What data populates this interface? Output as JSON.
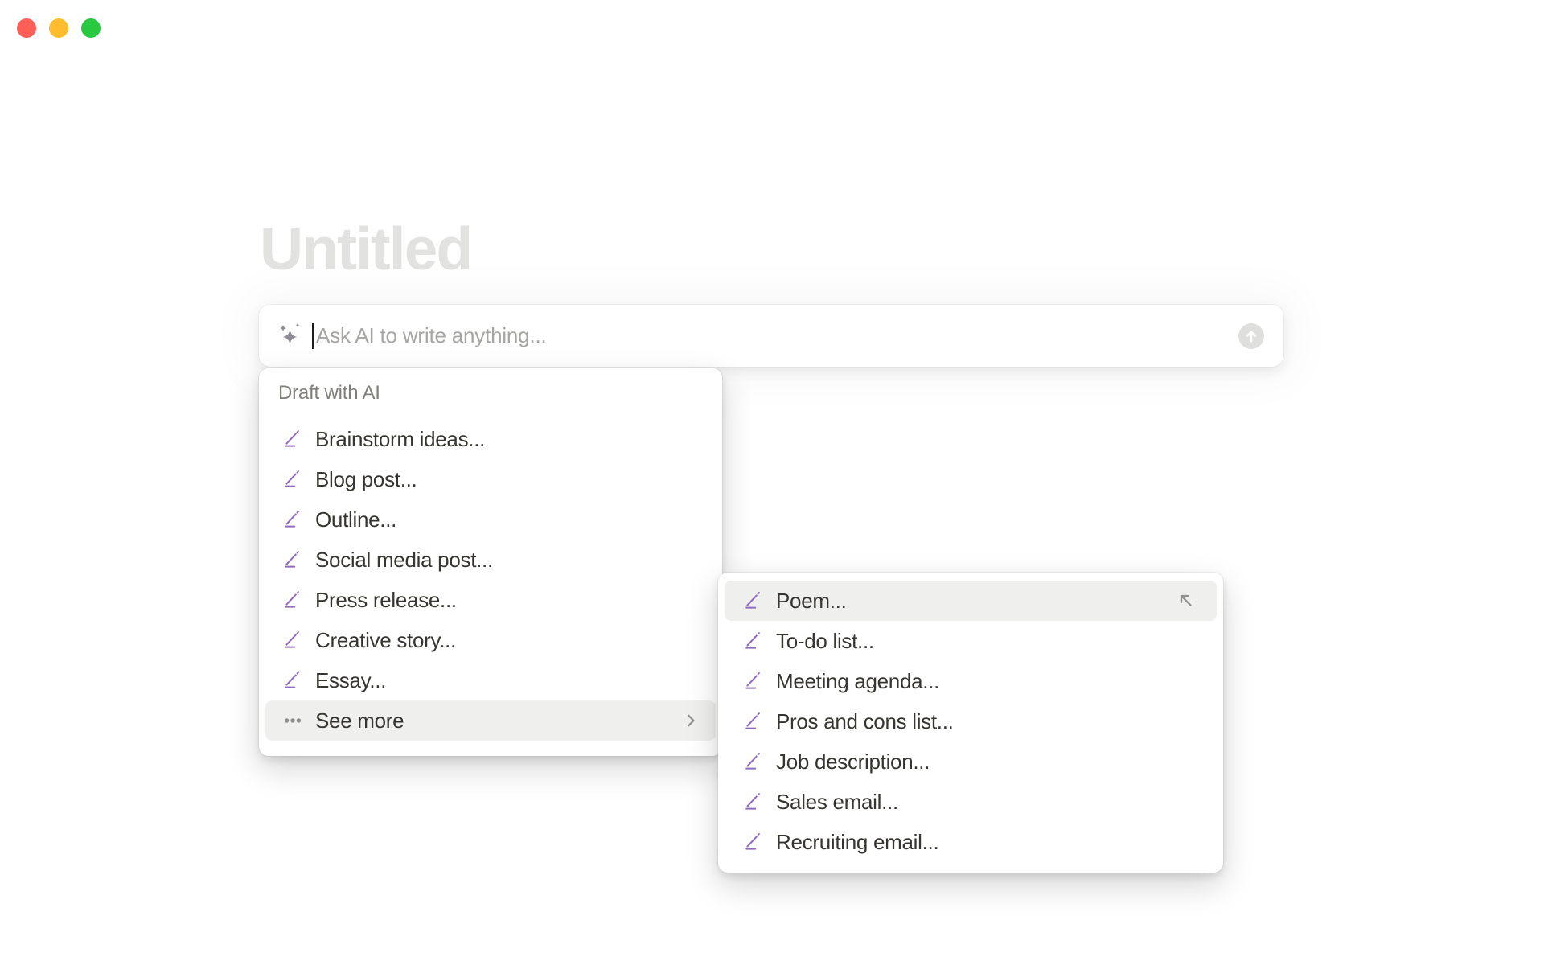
{
  "window": {
    "traffic_lights": [
      {
        "name": "close",
        "color": "#FF5F57"
      },
      {
        "name": "minimize",
        "color": "#FEBC2E"
      },
      {
        "name": "zoom",
        "color": "#28C840"
      }
    ]
  },
  "page": {
    "title_placeholder": "Untitled"
  },
  "ai_input": {
    "placeholder": "Ask AI to write anything...",
    "leading_icon": "ai-sparkle-icon",
    "submit_icon": "arrow-up-icon"
  },
  "draft_menu": {
    "header": "Draft with AI",
    "items": [
      {
        "label": "Brainstorm ideas...",
        "icon": "pencil-icon",
        "highlighted": false
      },
      {
        "label": "Blog post...",
        "icon": "pencil-icon",
        "highlighted": false
      },
      {
        "label": "Outline...",
        "icon": "pencil-icon",
        "highlighted": false
      },
      {
        "label": "Social media post...",
        "icon": "pencil-icon",
        "highlighted": false
      },
      {
        "label": "Press release...",
        "icon": "pencil-icon",
        "highlighted": false
      },
      {
        "label": "Creative story...",
        "icon": "pencil-icon",
        "highlighted": false
      },
      {
        "label": "Essay...",
        "icon": "pencil-icon",
        "highlighted": false
      },
      {
        "label": "See more",
        "icon": "ellipsis-icon",
        "trailing_icon": "chevron-right-icon",
        "highlighted": true
      }
    ]
  },
  "see_more_submenu": {
    "items": [
      {
        "label": "Poem...",
        "icon": "pencil-icon",
        "trailing_icon": "arrow-up-left-icon",
        "highlighted": true
      },
      {
        "label": "To-do list...",
        "icon": "pencil-icon",
        "highlighted": false
      },
      {
        "label": "Meeting agenda...",
        "icon": "pencil-icon",
        "highlighted": false
      },
      {
        "label": "Pros and cons list...",
        "icon": "pencil-icon",
        "highlighted": false
      },
      {
        "label": "Job description...",
        "icon": "pencil-icon",
        "highlighted": false
      },
      {
        "label": "Sales email...",
        "icon": "pencil-icon",
        "highlighted": false
      },
      {
        "label": "Recruiting email...",
        "icon": "pencil-icon",
        "highlighted": false
      }
    ]
  },
  "colors": {
    "accent_purple": "#9169BE",
    "row_highlight": "#EFEFEE",
    "icon_gray": "#8F8E8A",
    "text_primary": "#37352F",
    "text_secondary": "#807E79",
    "placeholder_gray": "#A6A5A2",
    "title_placeholder_gray": "#E2E2E1",
    "submit_circle_gray": "#DFDFDE"
  }
}
